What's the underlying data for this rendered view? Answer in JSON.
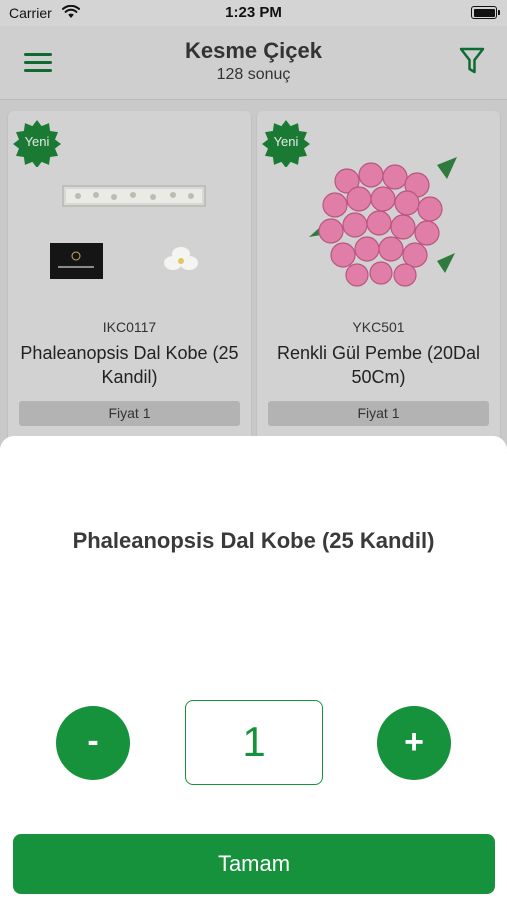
{
  "status_bar": {
    "carrier": "Carrier",
    "time": "1:23 PM"
  },
  "nav": {
    "title": "Kesme Çiçek",
    "subtitle": "128 sonuç"
  },
  "products": [
    {
      "badge": "Yeni",
      "code": "IKC0117",
      "name": "Phaleanopsis Dal Kobe (25 Kandil)",
      "price_label": "Fiyat 1"
    },
    {
      "badge": "Yeni",
      "code": "YKC501",
      "name": "Renkli Gül Pembe (20Dal 50Cm)",
      "price_label": "Fiyat 1"
    }
  ],
  "sheet": {
    "title": "Phaleanopsis Dal Kobe (25 Kandil)",
    "minus_label": "-",
    "quantity": "1",
    "plus_label": "+",
    "confirm_label": "Tamam"
  },
  "colors": {
    "accent": "#17923c",
    "badge": "#1a7a33",
    "overlay": "#c9c9c9"
  }
}
